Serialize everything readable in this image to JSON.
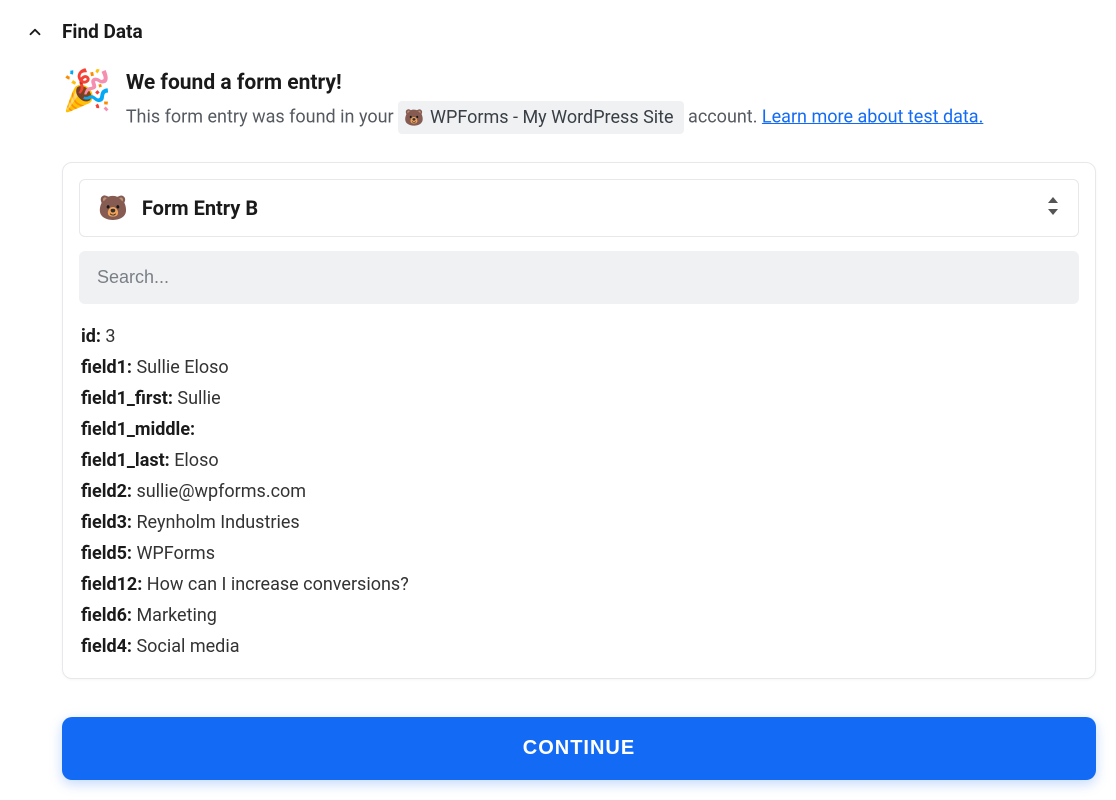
{
  "section_title": "Find Data",
  "banner": {
    "heading": "We found a form entry!",
    "prefix_text": "This form entry was found in your ",
    "account_name": "WPForms - My WordPress Site",
    "suffix_text": " account. ",
    "learn_link": "Learn more about test data."
  },
  "entry_selector": {
    "label": "Form Entry B"
  },
  "search": {
    "placeholder": "Search..."
  },
  "fields": [
    {
      "key": "id:",
      "value": "3"
    },
    {
      "key": "field1:",
      "value": "Sullie Eloso"
    },
    {
      "key": "field1_first:",
      "value": "Sullie"
    },
    {
      "key": "field1_middle:",
      "value": ""
    },
    {
      "key": "field1_last:",
      "value": "Eloso"
    },
    {
      "key": "field2:",
      "value": "sullie@wpforms.com"
    },
    {
      "key": "field3:",
      "value": "Reynholm Industries"
    },
    {
      "key": "field5:",
      "value": "WPForms"
    },
    {
      "key": "field12:",
      "value": "How can I increase conversions?"
    },
    {
      "key": "field6:",
      "value": "Marketing"
    },
    {
      "key": "field4:",
      "value": "Social media"
    }
  ],
  "continue_label": "CONTINUE"
}
